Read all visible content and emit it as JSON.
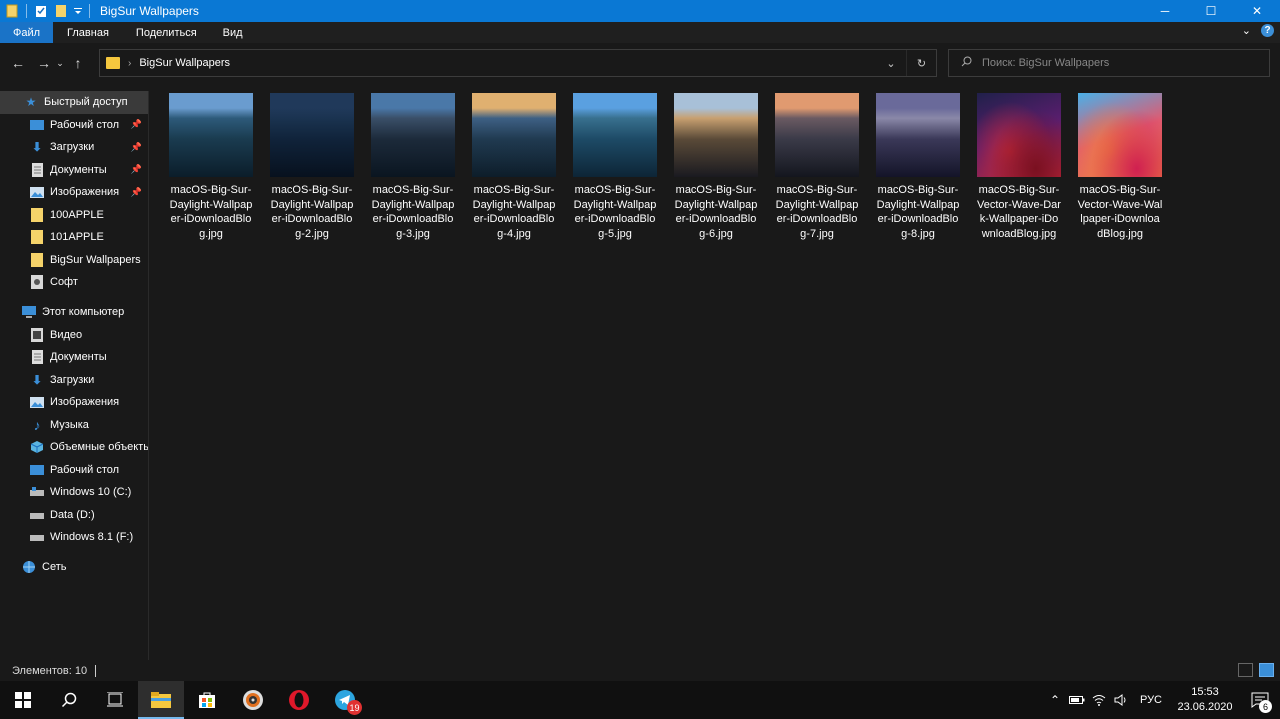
{
  "window": {
    "title": "BigSur Wallpapers",
    "minimize": "─",
    "maximize": "☐",
    "close": "✕"
  },
  "ribbon": {
    "tabs": [
      "Файл",
      "Главная",
      "Поделиться",
      "Вид"
    ]
  },
  "address": {
    "path": "BigSur Wallpapers"
  },
  "search": {
    "placeholder": "Поиск: BigSur Wallpapers"
  },
  "sidebar": {
    "quick_access": "Быстрый доступ",
    "quick_items": [
      {
        "label": "Рабочий стол",
        "icon": "desktop-icon",
        "pinned": true
      },
      {
        "label": "Загрузки",
        "icon": "downloads-icon",
        "pinned": true
      },
      {
        "label": "Документы",
        "icon": "documents-icon",
        "pinned": true
      },
      {
        "label": "Изображения",
        "icon": "pictures-icon",
        "pinned": true
      },
      {
        "label": "100APPLE",
        "icon": "folder-icon",
        "pinned": false
      },
      {
        "label": "101APPLE",
        "icon": "folder-icon",
        "pinned": false
      },
      {
        "label": "BigSur Wallpapers",
        "icon": "folder-icon",
        "pinned": false
      },
      {
        "label": "Софт",
        "icon": "software-folder-icon",
        "pinned": false
      }
    ],
    "this_pc": "Этот компьютер",
    "pc_items": [
      {
        "label": "Видео",
        "icon": "video-icon"
      },
      {
        "label": "Документы",
        "icon": "documents-icon"
      },
      {
        "label": "Загрузки",
        "icon": "downloads-icon"
      },
      {
        "label": "Изображения",
        "icon": "pictures-icon"
      },
      {
        "label": "Музыка",
        "icon": "music-icon"
      },
      {
        "label": "Объемные объекты",
        "icon": "3d-objects-icon"
      },
      {
        "label": "Рабочий стол",
        "icon": "desktop-icon"
      },
      {
        "label": "Windows 10 (C:)",
        "icon": "drive-icon"
      },
      {
        "label": "Data (D:)",
        "icon": "drive-icon"
      },
      {
        "label": "Windows 8.1 (F:)",
        "icon": "drive-icon"
      }
    ],
    "network": "Сеть"
  },
  "files": [
    {
      "line1": "macOS-Big-Sur-",
      "line2": "Daylight-Wallpap",
      "line3": "er-iDownloadBlo",
      "line4": "g.jpg",
      "colors": [
        "#6a9ccf",
        "#2d5a7a",
        "#1a3b4f",
        "#0b1d2a"
      ]
    },
    {
      "line1": "macOS-Big-Sur-",
      "line2": "Daylight-Wallpap",
      "line3": "er-iDownloadBlo",
      "line4": "g-2.jpg",
      "colors": [
        "#20395a",
        "#1a3350",
        "#10233a",
        "#07111e"
      ]
    },
    {
      "line1": "macOS-Big-Sur-",
      "line2": "Daylight-Wallpap",
      "line3": "er-iDownloadBlo",
      "line4": "g-3.jpg",
      "colors": [
        "#4a78a8",
        "#3a4f68",
        "#1c2a3a",
        "#0a1520"
      ]
    },
    {
      "line1": "macOS-Big-Sur-",
      "line2": "Daylight-Wallpap",
      "line3": "er-iDownloadBlo",
      "line4": "g-4.jpg",
      "colors": [
        "#e0b070",
        "#3e6084",
        "#203a50",
        "#0d1d2a"
      ]
    },
    {
      "line1": "macOS-Big-Sur-",
      "line2": "Daylight-Wallpap",
      "line3": "er-iDownloadBlo",
      "line4": "g-5.jpg",
      "colors": [
        "#5aa0e0",
        "#38708e",
        "#1d4a66",
        "#0d2536"
      ]
    },
    {
      "line1": "macOS-Big-Sur-",
      "line2": "Daylight-Wallpap",
      "line3": "er-iDownloadBlo",
      "line4": "g-6.jpg",
      "colors": [
        "#a8c0d8",
        "#c8a070",
        "#5a4a38",
        "#1a1a20"
      ]
    },
    {
      "line1": "macOS-Big-Sur-",
      "line2": "Daylight-Wallpap",
      "line3": "er-iDownloadBlo",
      "line4": "g-7.jpg",
      "colors": [
        "#e09a70",
        "#6a5a62",
        "#3a3a48",
        "#14161e"
      ]
    },
    {
      "line1": "macOS-Big-Sur-",
      "line2": "Daylight-Wallpap",
      "line3": "er-iDownloadBlo",
      "line4": "g-8.jpg",
      "colors": [
        "#6a6a9a",
        "#8a88a8",
        "#3a3858",
        "#141428"
      ]
    },
    {
      "line1": "macOS-Big-Sur-",
      "line2": "Vector-Wave-Dar",
      "line3": "k-Wallpaper-iDo",
      "line4": "wnloadBlog.jpg",
      "colors": [
        "#20204a",
        "#5a1e6e",
        "#c0283a",
        "#7a1020"
      ]
    },
    {
      "line1": "macOS-Big-Sur-",
      "line2": "Vector-Wave-Wal",
      "line3": "lpaper-iDownloa",
      "line4": "dBlog.jpg",
      "colors": [
        "#4ab0e8",
        "#e05a70",
        "#f08040",
        "#d02050"
      ]
    }
  ],
  "status": {
    "count": "Элементов: 10"
  },
  "taskbar": {
    "telegram_badge": "19",
    "lang": "РУС",
    "time": "15:53",
    "date": "23.06.2020",
    "notif_count": "6"
  }
}
